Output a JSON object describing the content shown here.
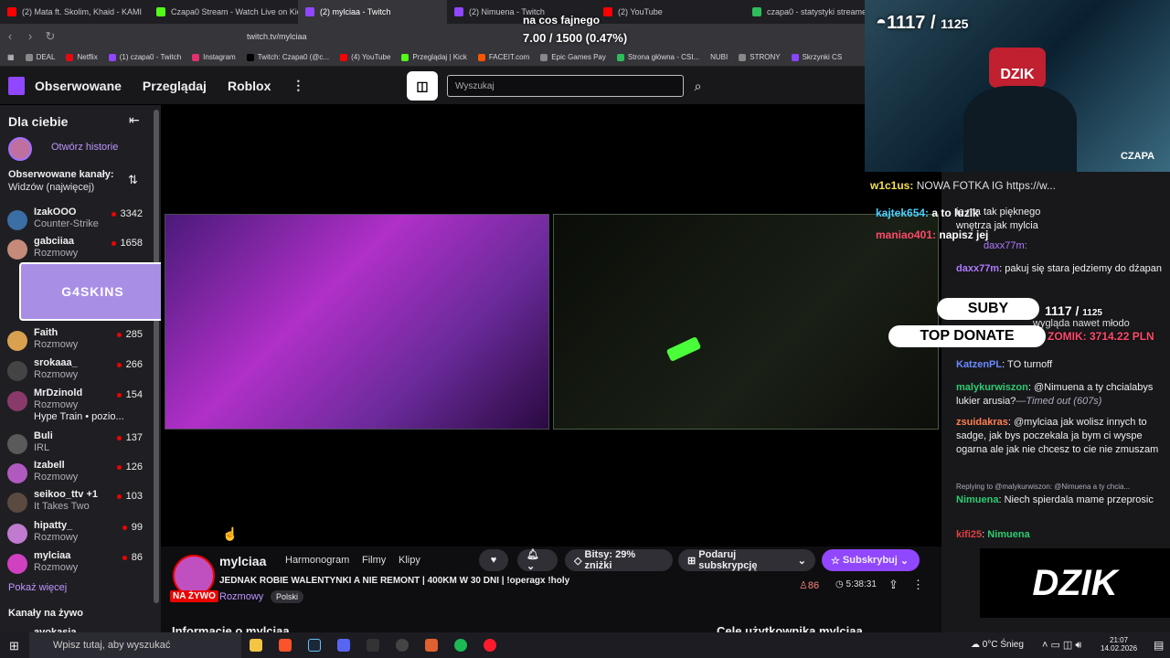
{
  "browser": {
    "tabs": [
      {
        "title": "(2) Mata ft. Skolim, Khaid - KAMI",
        "color": "#ff0000"
      },
      {
        "title": "Czapa0 Stream - Watch Live on Kick",
        "color": "#53fc18"
      },
      {
        "title": "(2) mylciaa - Twitch",
        "color": "#9146ff"
      },
      {
        "title": "(2) Nimuena - Twitch",
        "color": "#9146ff"
      },
      {
        "title": "(2) YouTube",
        "color": "#ff0000"
      },
      {
        "title": "czapa0 - statystyki streamera",
        "color": "#2dbd5a"
      }
    ],
    "url": "twitch.tv/mylciaa",
    "bookmarks": [
      {
        "label": "DEAL",
        "color": "#888"
      },
      {
        "label": "Netflix",
        "color": "#e50914"
      },
      {
        "label": "(1) czapa0 - Twitch",
        "color": "#9146ff"
      },
      {
        "label": "Instagram",
        "color": "#e1306c"
      },
      {
        "label": "Twitch: Czapa0 (@c...",
        "color": "#000"
      },
      {
        "label": "(4) YouTube",
        "color": "#ff0000"
      },
      {
        "label": "Przeglądaj | Kick",
        "color": "#53fc18"
      },
      {
        "label": "FACEIT.com",
        "color": "#ff5500"
      },
      {
        "label": "Epic Games Pay",
        "color": "#888"
      },
      {
        "label": "Strona główna - CSI...",
        "color": "#2dbd5a"
      },
      {
        "label": "NUBI",
        "color": "#555"
      },
      {
        "label": "STRONY",
        "color": "#888"
      },
      {
        "label": "Skrzynki CS",
        "color": "#8b44ff"
      }
    ]
  },
  "twitch": {
    "nav": [
      "Obserwowane",
      "Przeglądaj",
      "Roblox"
    ],
    "search_placeholder": "Wyszukaj",
    "sidebar": {
      "title": "Dla ciebie",
      "open_stories": "Otwórz historie",
      "followed_title": "Obserwowane kanały:",
      "followed_sort": "Widzów (najwięcej)",
      "channels": [
        {
          "name": "IzakOOO",
          "category": "Counter-Strike",
          "viewers": "3342",
          "color": "#3a6ea5"
        },
        {
          "name": "gabciiaa",
          "category": "Rozmowy",
          "viewers": "1658",
          "color": "#c58a7a"
        },
        {
          "name": "Faith",
          "category": "Rozmowy",
          "viewers": "285",
          "color": "#d9a050"
        },
        {
          "name": "srokaaa_",
          "category": "Rozmowy",
          "viewers": "266",
          "color": "#444"
        },
        {
          "name": "MrDzinold",
          "category": "Rozmowy",
          "viewers": "154",
          "color": "#8a3a6a"
        },
        {
          "name": "Buli",
          "category": "IRL",
          "viewers": "137",
          "color": "#5a5a5a"
        },
        {
          "name": "Izabell",
          "category": "Rozmowy",
          "viewers": "126",
          "color": "#b05ac0"
        },
        {
          "name": "seikoo_ttv +1",
          "category": "It Takes Two",
          "viewers": "103",
          "color": "#5a4a40"
        },
        {
          "name": "hipatty_",
          "category": "Rozmowy",
          "viewers": "99",
          "color": "#c07ad0"
        },
        {
          "name": "mylciaa",
          "category": "Rozmowy",
          "viewers": "86",
          "color": "#d040c0"
        }
      ],
      "hype_train": "Hype Train • pozio...",
      "show_more": "Pokaż więcej",
      "live_title": "Kanały na żywo",
      "live_partial": "avokasia"
    },
    "stream": {
      "channel": "mylciaa",
      "tabs": [
        "Harmonogram",
        "Filmy",
        "Klipy"
      ],
      "bits_label": "Bitsy: 29% zniżki",
      "gift_label": "Podaruj subskrypcję",
      "subscribe_label": "Subskrybuj",
      "title": "JEDNAK ROBIE WALENTYNKI A NIE REMONT | 400KM W 30 DNI | !operagx !holy",
      "category": "Rozmowy",
      "tag": "Polski",
      "live_badge": "NA ŻYWO",
      "viewers": "86",
      "uptime": "5:38:31",
      "about": "Informacje o mylciaa",
      "goals": "Cele użytkownika mylciaa"
    },
    "chat": [
      {
        "user": "daxx77m",
        "text": "pakuj się stara jedziemy do dźapan",
        "user_color": "#b07aff"
      },
      {
        "user": "KatzenPL",
        "text": "TO turnoff",
        "user_color": "#6a8aff"
      },
      {
        "user": "malykurwiszon",
        "text": "@Nimuena a ty chcialabys lukier arusia?",
        "extra": "—Timed out (607s)",
        "user_color": "#2ecc71"
      },
      {
        "user": "zsuidakras",
        "text": "@mylciaa jak wolisz innych to sadge, jak bys poczekala ja bym ci wyspe ogarna ale jak nie chcesz to cie nie zmuszam",
        "user_color": "#ff7f50"
      },
      {
        "user": "Nimuena",
        "text": "Niech spierdala mame przeprosic",
        "reply": "Replying to @malykurwiszon: @Nimuena a ty chcia...",
        "user_color": "#2ecc71"
      },
      {
        "user": "kifi25",
        "text": "Nimuena",
        "user_color": "#e04040"
      }
    ]
  },
  "overlay": {
    "sub_count": "1117",
    "sub_goal": "1125",
    "goal_text": "na cos fajnego",
    "goal_value": "7.00 / 1500 (0.47%)",
    "brand": "DZIK",
    "cam_label": "CZAPA",
    "suby_label": "SUBY",
    "top_donate_label": "TOP DONATE",
    "top_donate_value": "ZOMIK: 3714.22 PLN",
    "overlay_chat": [
      {
        "user": "w1c1us:",
        "text": "NOWA FOTKA IG https://w..."
      },
      {
        "user": "kajtek654:",
        "text": "a to luzik"
      },
      {
        "user": "maniao401:",
        "text": "napisz jej"
      }
    ],
    "behind_text": [
      "ie ma tak pięknego",
      "wnętrza jak mylcia",
      "daxx77m:",
      "wygląda nawet młodo"
    ]
  },
  "taskbar": {
    "search_placeholder": "Wpisz tutaj, aby wyszukać",
    "weather": "0°C Śnieg",
    "time": "21:07",
    "date": "14.02.2026"
  }
}
